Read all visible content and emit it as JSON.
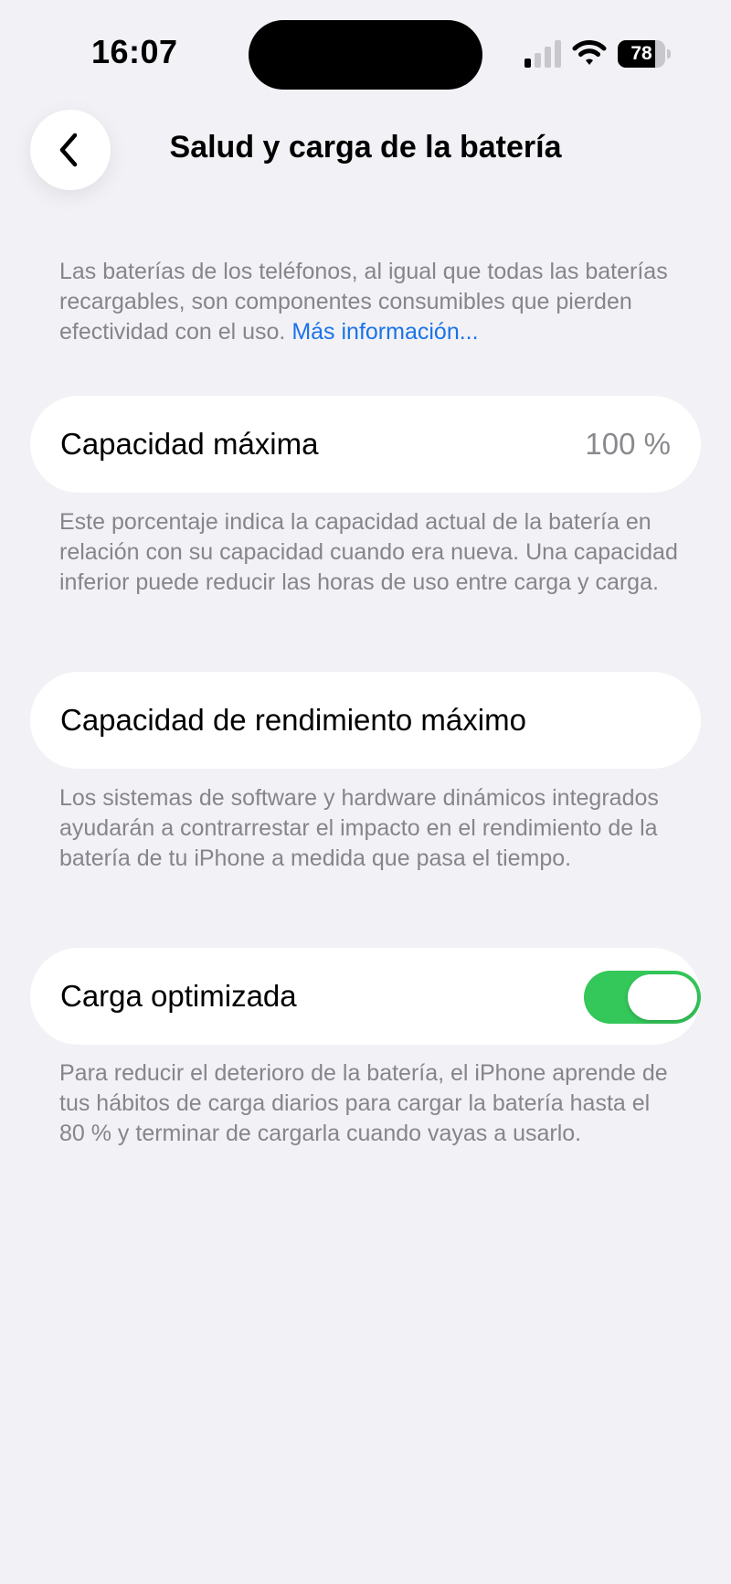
{
  "status_bar": {
    "time": "16:07",
    "battery_level": "78",
    "battery_fraction": 0.78,
    "signal_bars_active": 1,
    "signal_bars_total": 4,
    "icons": [
      "cellular-signal-icon",
      "wifi-icon",
      "battery-icon"
    ]
  },
  "nav": {
    "back_icon": "chevron-left-icon",
    "title": "Salud y carga de la batería"
  },
  "intro": {
    "text": "Las baterías de los teléfonos, al igual que todas las baterías recargables, son componentes consumibles que pierden efectividad con el uso. ",
    "link": "Más información..."
  },
  "max_capacity": {
    "label": "Capacidad máxima",
    "value": "100 %",
    "footnote": "Este porcentaje indica la capacidad actual de la batería en relación con su capacidad cuando era nueva. Una capacidad inferior puede reducir las horas de uso entre carga y carga."
  },
  "peak_performance": {
    "label": "Capacidad de rendimiento máximo",
    "footnote": "Los sistemas de software y hardware dinámicos integrados ayudarán a contrarrestar el impacto en el rendimiento de la batería de tu iPhone a medida que pasa el tiempo."
  },
  "optimized_charging": {
    "label": "Carga optimizada",
    "enabled": true,
    "footnote": "Para reducir el deterioro de la batería, el iPhone aprende de tus hábitos de carga diarios para cargar la batería hasta el 80 % y terminar de cargarla cuando vayas a usarlo."
  },
  "colors": {
    "background": "#f2f1f6",
    "cell": "#ffffff",
    "secondary_text": "#85858b",
    "link": "#1a73e8",
    "toggle_on": "#34c759"
  }
}
